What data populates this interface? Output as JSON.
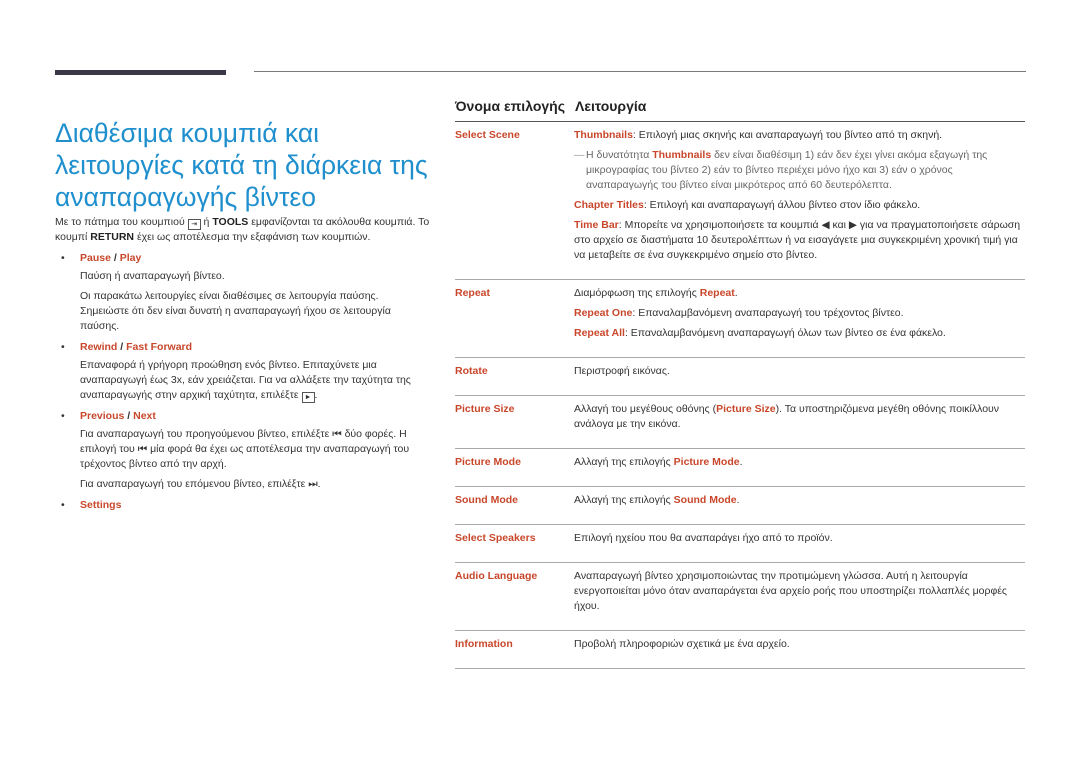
{
  "title": "Διαθέσιμα κουμπιά και λειτουργίες κατά τη διάρκεια της αναπαραγωγής βίντεο",
  "intro": {
    "part1": "Με το πάτημα του κουμπιού",
    "icon": "tools-icon",
    "part2": "ή",
    "tools": "TOOLS",
    "part3": "εμφανίζονται τα ακόλουθα κουμπιά. Το κουμπί",
    "return": "RETURN",
    "part4": "έχει ως αποτέλεσμα την εξαφάνιση των κουμπιών."
  },
  "bullets": [
    {
      "a": "Pause",
      "b": "Play",
      "texts": [
        "Παύση ή αναπαραγωγή βίντεο.",
        "Οι παρακάτω λειτουργίες είναι διαθέσιμες σε λειτουργία παύσης. Σημειώστε ότι δεν είναι δυνατή η αναπαραγωγή ήχου σε λειτουργία παύσης."
      ]
    },
    {
      "a": "Rewind",
      "b": "Fast Forward",
      "text1": "Επαναφορά ή γρήγορη προώθηση ενός βίντεο. Επιταχύνετε μια αναπαραγωγή έως 3x, εάν χρειάζεται. Για να αλλάξετε την ταχύτητα της αναπαραγωγής στην αρχική ταχύτητα, επιλέξτε",
      "icon": "►"
    },
    {
      "a": "Previous",
      "b": "Next",
      "t1a": "Για αναπαραγωγή του προηγούμενου βίντεο, επιλέξτε",
      "t1b": "δύο φορές. Η επιλογή του",
      "t1c": "μία φορά θα έχει ως αποτέλεσμα την αναπαραγωγή του τρέχοντος βίντεο από την αρχή.",
      "t2": "Για αναπαραγωγή του επόμενου βίντεο, επιλέξτε",
      "prev_icon": "⏮",
      "next_icon": "⏭"
    },
    {
      "a": "Settings"
    }
  ],
  "table": {
    "col1": "Όνομα επιλογής",
    "col2": "Λειτουργία",
    "rows": {
      "select_scene": {
        "name": "Select Scene",
        "thumb_label": "Thumbnails",
        "thumb_text": ": Επιλογή μιας σκηνής και αναπαραγωγή του βίντεο από τη σκηνή.",
        "note_a": "Η δυνατότητα",
        "note_hl": "Thumbnails",
        "note_b": "δεν είναι διαθέσιμη 1) εάν δεν έχει γίνει ακόμα εξαγωγή της μικρογραφίας του βίντεο 2) εάν το βίντεο περιέχει μόνο ήχο και 3) εάν ο χρόνος αναπαραγωγής του βίντεο είναι μικρότερος από 60 δευτερόλεπτα.",
        "chapter_label": "Chapter Titles",
        "chapter_text": ": Επιλογή και αναπαραγωγή άλλου βίντεο στον ίδιο φάκελο.",
        "time_label": "Time Bar",
        "time_a": ": Μπορείτε να χρησιμοποιήσετε τα κουμπιά",
        "time_b": "και",
        "time_c": "για να πραγματοποιήσετε σάρωση στο αρχείο σε διαστήματα 10 δευτερολέπτων ή να εισαγάγετε μια συγκεκριμένη χρονική τιμή για να μεταβείτε σε ένα συγκεκριμένο σημείο στο βίντεο.",
        "left_icon": "◀",
        "right_icon": "▶"
      },
      "repeat": {
        "name": "Repeat",
        "text_a": "Διαμόρφωση της επιλογής",
        "text_hl": "Repeat",
        "text_b": ".",
        "one_label": "Repeat One",
        "one_text": ": Επαναλαμβανόμενη αναπαραγωγή του τρέχοντος βίντεο.",
        "all_label": "Repeat All",
        "all_text": ": Επαναλαμβανόμενη αναπαραγωγή όλων των βίντεο σε ένα φάκελο."
      },
      "rotate": {
        "name": "Rotate",
        "text": "Περιστροφή εικόνας."
      },
      "picture_size": {
        "name": "Picture Size",
        "text_a": "Αλλαγή του μεγέθους οθόνης (",
        "text_hl": "Picture Size",
        "text_b": "). Τα υποστηριζόμενα μεγέθη οθόνης ποικίλλουν ανάλογα με την εικόνα."
      },
      "picture_mode": {
        "name": "Picture Mode",
        "text_a": "Αλλαγή της επιλογής",
        "text_hl": "Picture Mode",
        "text_b": "."
      },
      "sound_mode": {
        "name": "Sound Mode",
        "text_a": "Αλλαγή της επιλογής",
        "text_hl": "Sound Mode",
        "text_b": "."
      },
      "select_speakers": {
        "name": "Select Speakers",
        "text": "Επιλογή ηχείου που θα αναπαράγει ήχο από το προϊόν."
      },
      "audio_language": {
        "name": "Audio Language",
        "text": "Αναπαραγωγή βίντεο χρησιμοποιώντας την προτιμώμενη γλώσσα. Αυτή η λειτουργία ενεργοποιείται μόνο όταν αναπαράγεται ένα αρχείο ροής που υποστηρίζει πολλαπλές μορφές ήχου."
      },
      "information": {
        "name": "Information",
        "text": "Προβολή πληροφοριών σχετικά με ένα αρχείο."
      }
    }
  },
  "colors": {
    "title": "#1f8fcd",
    "accent": "#c8472b",
    "header_bar": "#3a3848"
  }
}
